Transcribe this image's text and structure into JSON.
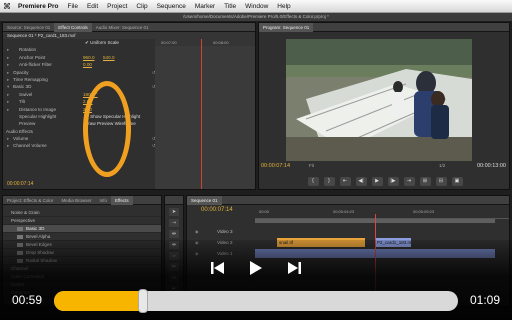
{
  "menubar": {
    "app": "Premiere Pro",
    "items": [
      "File",
      "Edit",
      "Project",
      "Clip",
      "Sequence",
      "Marker",
      "Title",
      "Window",
      "Help"
    ]
  },
  "path": "/Users/home/Documents/Adobe/Premiere Pro/5.0/Effects & Color.prproj *",
  "effect_controls": {
    "tabs": [
      "Source: Sequence 01",
      "Effect Controls",
      "Audio Mixer: Sequence 01"
    ],
    "clip": "Sequence 01 * P2_card1_183.mxf",
    "ruler": [
      "00:07:00",
      "00:08:00"
    ],
    "rows": [
      {
        "label": "",
        "check": "✔ Uniform Scale"
      },
      {
        "label": "Rotation"
      },
      {
        "label": "Anchor Point",
        "v1": "960.0",
        "v2": "540.0"
      },
      {
        "label": "Anti-flicker Filter",
        "v1": "0.00"
      },
      {
        "label": "Opacity"
      },
      {
        "label": "Time Remapping"
      },
      {
        "label": "Basic 3D"
      },
      {
        "label": "Swivel",
        "v1": "180.0 °"
      },
      {
        "label": "Tilt",
        "v1": "2.0 °"
      },
      {
        "label": "Distance to Image",
        "v1": "26.0"
      },
      {
        "label": "Specular Highlight",
        "check": "✔ Show Specular Highlight"
      },
      {
        "label": "Preview",
        "check": "Draw Preview Wireframe"
      },
      {
        "label": "Audio Effects"
      },
      {
        "label": "Volume"
      },
      {
        "label": "Channel Volume"
      }
    ],
    "time": "00:00:07:14"
  },
  "program_monitor": {
    "tab": "Program: Sequence 01",
    "time": "00:00:07:14",
    "fit": "Fit",
    "ratio": "1/2",
    "duration": "00:00:13:00",
    "controls": [
      "{",
      "}",
      "⇤",
      "◀|",
      "▶",
      "|▶",
      "⇥",
      "⊞",
      "⊟",
      "▣"
    ]
  },
  "project": {
    "tabs": [
      "Project: Effects & Color",
      "Media Browser",
      "Info",
      "Effects"
    ],
    "items": [
      {
        "label": "Noise & Grain",
        "level": 0,
        "fx": false
      },
      {
        "label": "Perspective",
        "level": 0,
        "fx": false
      },
      {
        "label": "Basic 3D",
        "level": 1,
        "fx": true,
        "selected": true
      },
      {
        "label": "Bevel Alpha",
        "level": 1,
        "fx": true
      },
      {
        "label": "Bevel Edges",
        "level": 1,
        "fx": true
      },
      {
        "label": "Drop Shadow",
        "level": 1,
        "fx": true
      },
      {
        "label": "Radial Shadow",
        "level": 1,
        "fx": true
      },
      {
        "label": "Channel",
        "level": 0,
        "fx": false
      },
      {
        "label": "Color Correction",
        "level": 0,
        "fx": false
      },
      {
        "label": "Distort",
        "level": 0,
        "fx": false
      },
      {
        "label": "Generate",
        "level": 0,
        "fx": false
      },
      {
        "label": "Image Control",
        "level": 0,
        "fx": false
      }
    ]
  },
  "timeline": {
    "tab": "Sequence 01",
    "time": "00:00:07:14",
    "ruler": [
      "00:00",
      "00:00:04:23",
      "00:00:09:23"
    ],
    "tracks": [
      "Video 3",
      "Video 2",
      "Video 1"
    ],
    "clips": {
      "v2_a": "snail.tif",
      "v2_b": "P2_card1_183.mxf"
    }
  },
  "player": {
    "current": "00:59",
    "total": "01:09",
    "progress": 0.22
  },
  "colors": {
    "accent": "#f7b500",
    "timecode": "#e3b23c",
    "highlight_circle": "#f0a020"
  }
}
